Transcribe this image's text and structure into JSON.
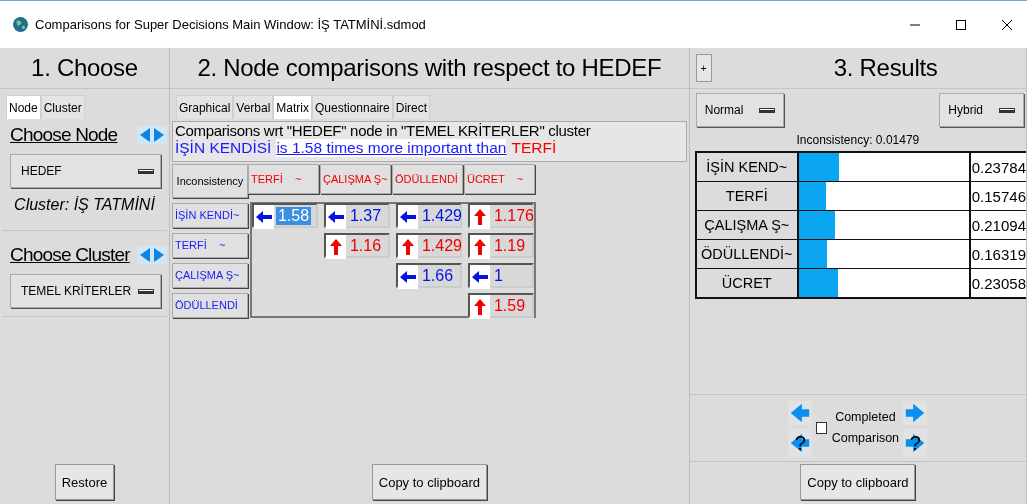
{
  "window": {
    "title": "Comparisons for Super Decisions Main Window: İŞ TATMİNİ.sdmod"
  },
  "choose": {
    "heading": "1. Choose",
    "tabs": [
      {
        "label": "Node",
        "selected": true
      },
      {
        "label": "Cluster",
        "selected": false
      }
    ],
    "choose_node": "Choose Node",
    "node": "HEDEF",
    "cluster_label": "Cluster: İŞ TATMİNİ",
    "choose_cluster": "Choose Cluster",
    "cluster": "TEMEL KRİTERLER",
    "restore": "Restore"
  },
  "comparisons": {
    "heading": "2. Node comparisons with respect to HEDEF",
    "tabs": [
      {
        "label": "Graphical",
        "selected": false
      },
      {
        "label": "Verbal",
        "selected": false
      },
      {
        "label": "Matrix",
        "selected": true
      },
      {
        "label": "Questionnaire",
        "selected": false
      },
      {
        "label": "Direct",
        "selected": false
      }
    ],
    "title": "Comparisons wrt \"HEDEF\" node in \"TEMEL KRİTERLER\" cluster",
    "sentence": {
      "left": "İŞİN KENDİSİ",
      "middle": "is 1.58 times more important than",
      "right": "TERFİ"
    },
    "corner": "Inconsistency",
    "columns": [
      "TERFİ    ~",
      "ÇALIŞMA Ş~",
      "ÖDÜLLENDİ",
      "ÜCRET    ~"
    ],
    "rows": [
      {
        "label": "İŞİN KENDİ~",
        "cells": [
          {
            "kind": "left",
            "value": "1.58",
            "selected": true
          },
          {
            "kind": "left",
            "value": "1.37",
            "selected": false
          },
          {
            "kind": "left",
            "value": "1.429",
            "selected": false
          },
          {
            "kind": "up",
            "value": "1.176",
            "selected": false
          }
        ]
      },
      {
        "label": "TERFİ    ~",
        "cells": [
          "",
          {
            "kind": "up",
            "value": "1.16",
            "selected": false
          },
          {
            "kind": "up",
            "value": "1.429",
            "selected": false
          },
          {
            "kind": "up",
            "value": "1.19",
            "selected": false
          }
        ]
      },
      {
        "label": "ÇALIŞMA Ş~",
        "cells": [
          "",
          "",
          {
            "kind": "left",
            "value": "1.66",
            "selected": false
          },
          {
            "kind": "left",
            "value": "1",
            "selected": false
          }
        ]
      },
      {
        "label": "ÖDÜLLENDİ",
        "cells": [
          "",
          "",
          "",
          {
            "kind": "up",
            "value": "1.59",
            "selected": false
          }
        ]
      }
    ],
    "copy": "Copy to clipboard"
  },
  "results": {
    "expand": "+",
    "heading": "3. Results",
    "mode": "Normal",
    "method": "Hybrid",
    "inconsistency": "Inconsistency: 0.01479",
    "rows": [
      {
        "name": "İŞİN KEND~",
        "level": 0.23784,
        "value": "0.23784"
      },
      {
        "name": "TERFİ",
        "level": 0.15746,
        "value": "0.15746"
      },
      {
        "name": "ÇALIŞMA Ş~",
        "level": 0.21094,
        "value": "0.21094"
      },
      {
        "name": "ÖDÜLLENDİ~",
        "level": 0.16319,
        "value": "0.16319"
      },
      {
        "name": "ÜCRET",
        "level": 0.23058,
        "value": "0.23058"
      }
    ],
    "prev_unanswered": "?",
    "next_unanswered": "?",
    "completed": {
      "label": "Completed Comparison",
      "checked": false
    },
    "copy": "Copy to clipboard"
  }
}
